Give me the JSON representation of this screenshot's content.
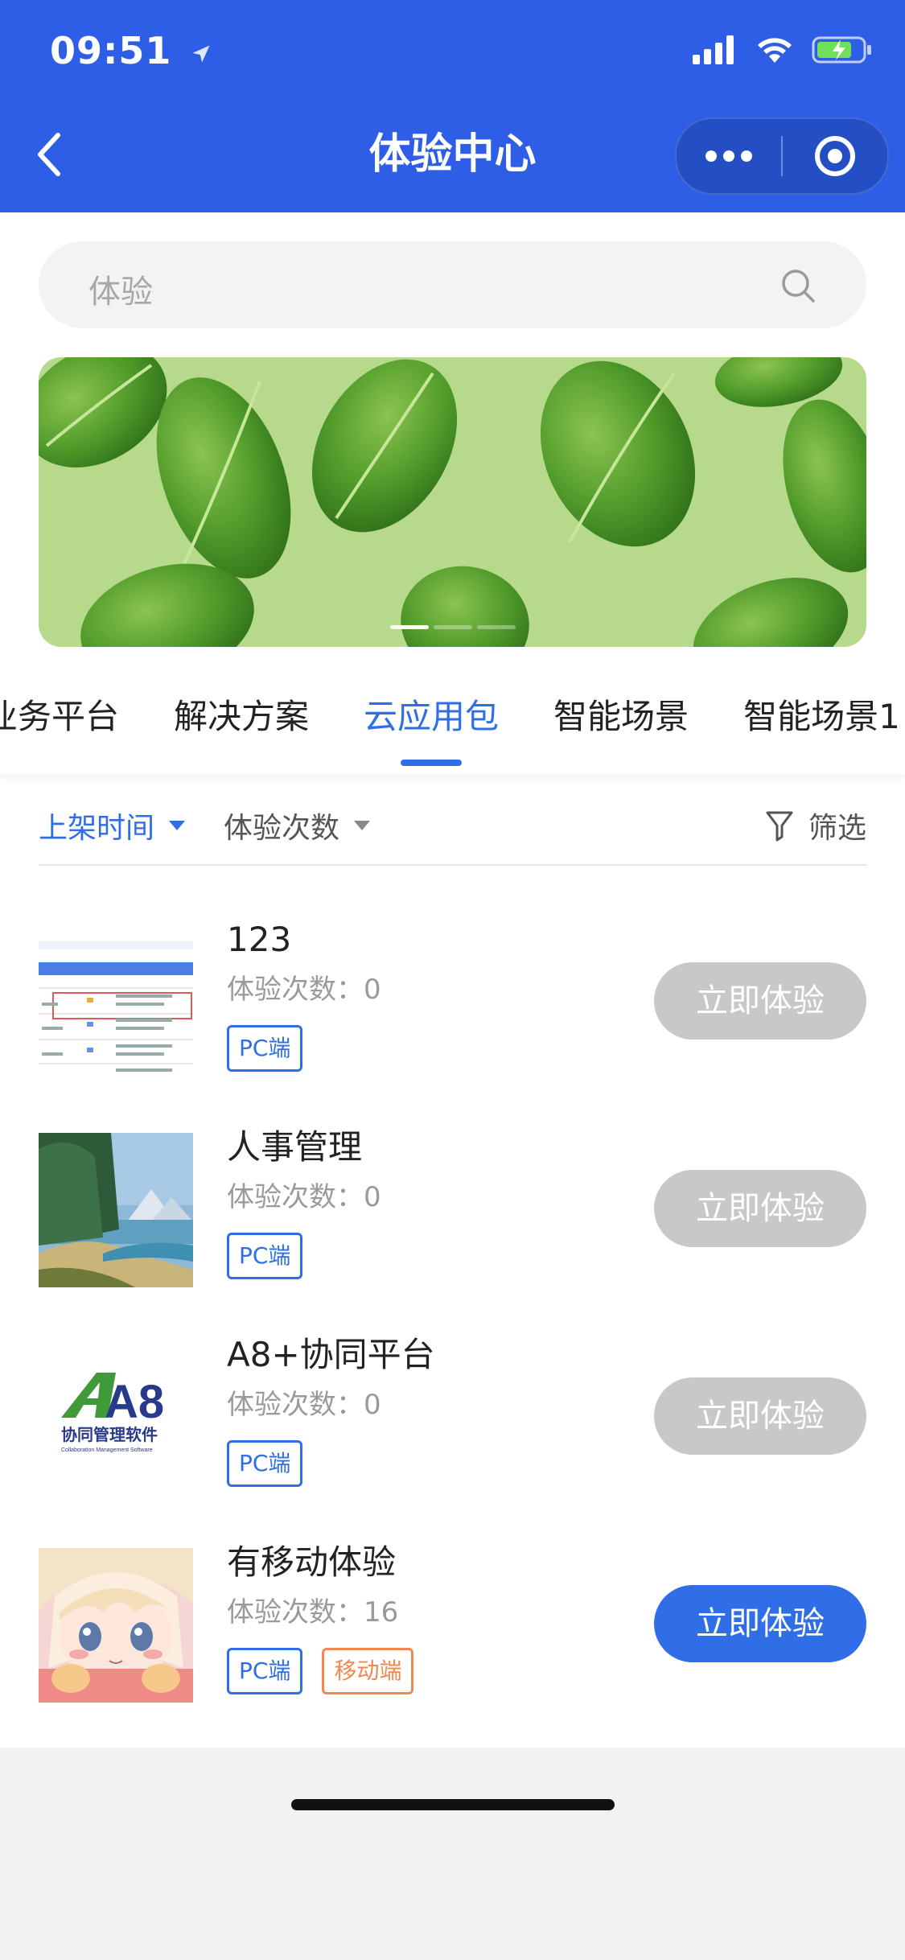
{
  "status_bar": {
    "time": "09:51"
  },
  "nav": {
    "title": "体验中心"
  },
  "search": {
    "placeholder": "体验"
  },
  "tabs": [
    {
      "label": "业务平台"
    },
    {
      "label": "解决方案"
    },
    {
      "label": "云应用包"
    },
    {
      "label": "智能场景"
    },
    {
      "label": "智能场景1"
    }
  ],
  "active_tab": "云应用包",
  "sort": {
    "shelf_time": "上架时间",
    "experience_count": "体验次数",
    "filter": "筛选"
  },
  "items": [
    {
      "title": "123",
      "count_label": "体验次数：",
      "count": "0",
      "tags": [
        "PC端"
      ],
      "button": "立即体验",
      "button_enabled": false
    },
    {
      "title": "人事管理",
      "count_label": "体验次数：",
      "count": "0",
      "tags": [
        "PC端"
      ],
      "button": "立即体验",
      "button_enabled": false
    },
    {
      "title": "A8+协同平台",
      "count_label": "体验次数：",
      "count": "0",
      "tags": [
        "PC端"
      ],
      "button": "立即体验",
      "button_enabled": false
    },
    {
      "title": "有移动体验",
      "count_label": "体验次数：",
      "count": "16",
      "tags": [
        "PC端",
        "移动端"
      ],
      "button": "立即体验",
      "button_enabled": true
    }
  ],
  "a8_logo": {
    "mark": "A8",
    "text_cn": "协同管理软件",
    "text_en": "Collaboration Management Software"
  },
  "colors": {
    "header": "#2f5ee6",
    "accent": "#2f6ee6",
    "button_disabled": "#c8c8c8",
    "tag_mobile": "#f0884f"
  }
}
